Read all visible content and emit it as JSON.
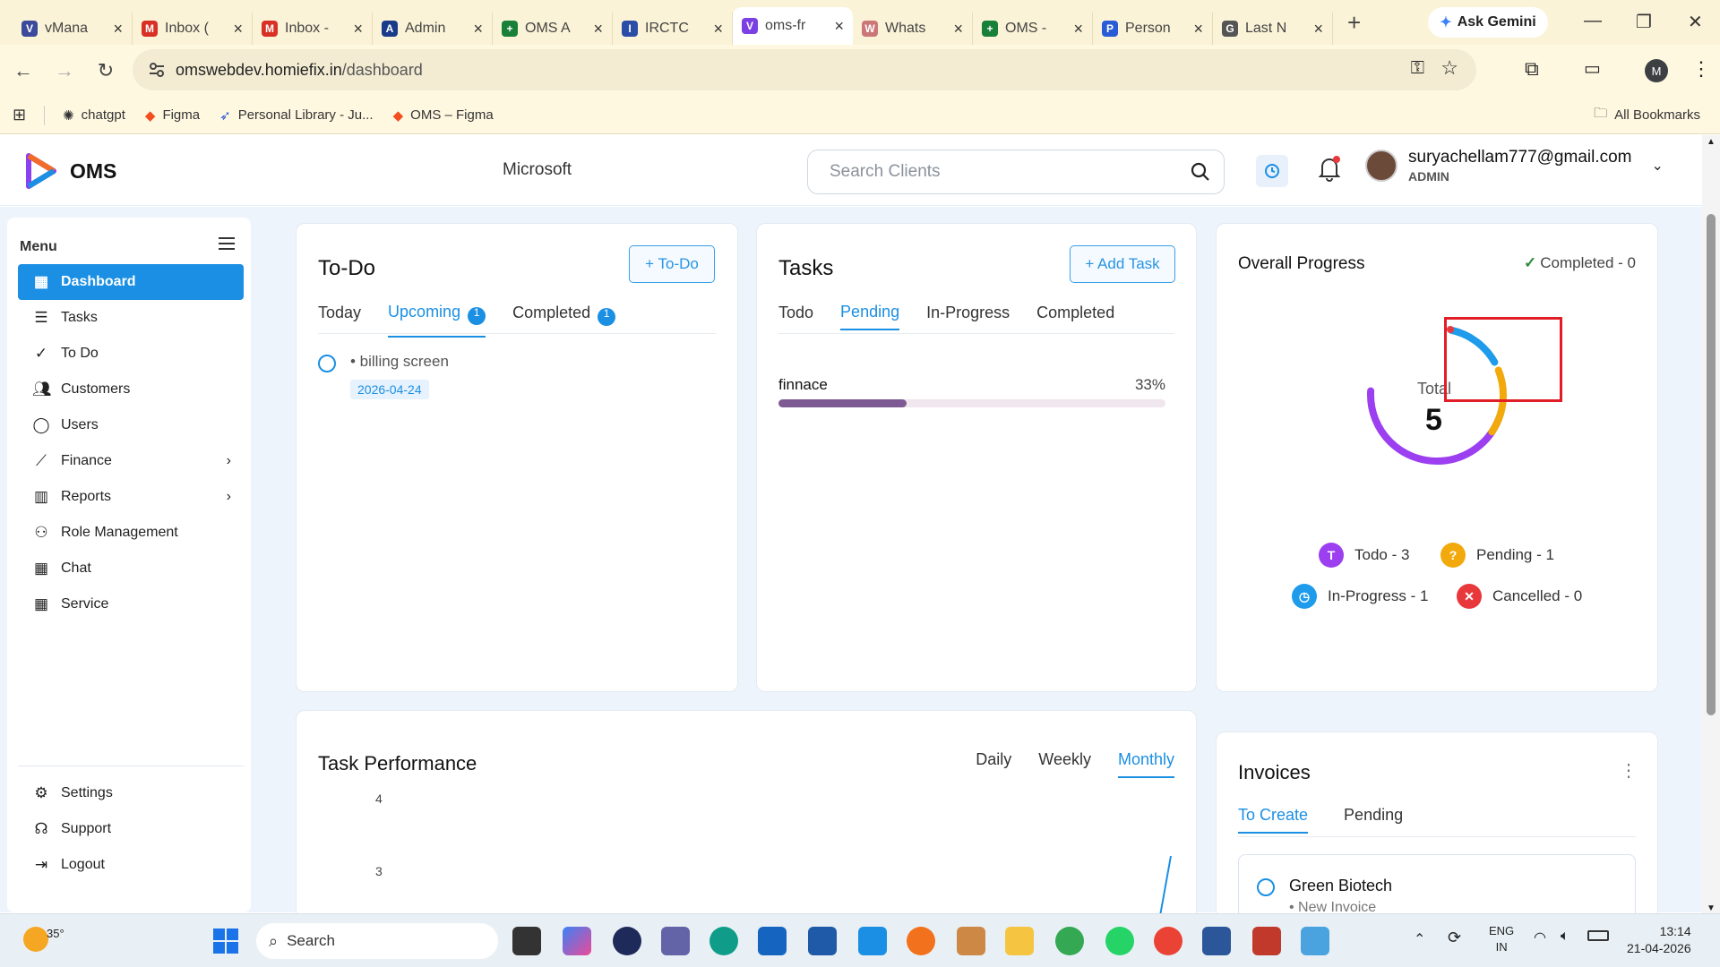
{
  "browser": {
    "tabs": [
      {
        "title": "vMana",
        "color": "#3b4a9a",
        "glyph": "V"
      },
      {
        "title": "Inbox (",
        "color": "#d93025",
        "glyph": "M"
      },
      {
        "title": "Inbox -",
        "color": "#d93025",
        "glyph": "M"
      },
      {
        "title": "Admin",
        "color": "#1a3a8a",
        "glyph": "A"
      },
      {
        "title": "OMS A",
        "color": "#188038",
        "glyph": "+"
      },
      {
        "title": "IRCTC",
        "color": "#2a4ea8",
        "glyph": "I"
      },
      {
        "title": "oms-fr",
        "color": "#7b3fe4",
        "glyph": "V",
        "active": true
      },
      {
        "title": "Whats",
        "color": "#c77",
        "glyph": "W"
      },
      {
        "title": "OMS -",
        "color": "#188038",
        "glyph": "+"
      },
      {
        "title": "Person",
        "color": "#2a5bd7",
        "glyph": "P"
      },
      {
        "title": "Last N",
        "color": "#555",
        "glyph": "G"
      }
    ],
    "ask_gemini": "Ask Gemini",
    "url_host": "omswebdev.homiefix.in",
    "url_path": "/dashboard",
    "profile_initial": "M",
    "bookmarks": [
      "chatgpt",
      "Figma",
      "Personal Library - Ju...",
      "OMS – Figma"
    ],
    "all_bookmarks": "All Bookmarks"
  },
  "header": {
    "brand": "OMS",
    "company": "Microsoft",
    "search_placeholder": "Search Clients",
    "user_email": "suryachellam777@gmail.com",
    "user_role": "ADMIN"
  },
  "sidebar": {
    "title": "Menu",
    "items": [
      {
        "label": "Dashboard",
        "icon": "dashboard-icon",
        "active": true
      },
      {
        "label": "Tasks",
        "icon": "tasks-icon"
      },
      {
        "label": "To Do",
        "icon": "todo-icon"
      },
      {
        "label": "Customers",
        "icon": "customers-icon"
      },
      {
        "label": "Users",
        "icon": "user-icon"
      },
      {
        "label": "Finance",
        "icon": "finance-icon",
        "chevron": true
      },
      {
        "label": "Reports",
        "icon": "reports-icon",
        "chevron": true
      },
      {
        "label": "Role Management",
        "icon": "role-icon"
      },
      {
        "label": "Chat",
        "icon": "chat-icon"
      },
      {
        "label": "Service",
        "icon": "service-icon"
      }
    ],
    "bottom": [
      {
        "label": "Settings",
        "icon": "gear-icon"
      },
      {
        "label": "Support",
        "icon": "headset-icon"
      },
      {
        "label": "Logout",
        "icon": "logout-icon"
      }
    ]
  },
  "todo": {
    "title": "To-Do",
    "add_label": "+ To-Do",
    "tabs": {
      "today": "Today",
      "upcoming": "Upcoming",
      "upcoming_count": "1",
      "completed": "Completed",
      "completed_count": "1"
    },
    "items": [
      {
        "text": "• billing screen",
        "date": "2026-04-24"
      }
    ]
  },
  "tasks": {
    "title": "Tasks",
    "add_label": "+ Add Task",
    "tabs": [
      "Todo",
      "Pending",
      "In-Progress",
      "Completed"
    ],
    "active_tab": "Pending",
    "items": [
      {
        "name": "finnace",
        "percent_label": "33%",
        "progress": 0.33
      }
    ]
  },
  "progress": {
    "title": "Overall Progress",
    "completed_label": "Completed - 0",
    "total_label": "Total",
    "total_value": "5",
    "legend": [
      {
        "label": "Todo - 3",
        "glyph": "T",
        "color": "#9b3ff0"
      },
      {
        "label": "Pending - 1",
        "glyph": "?",
        "color": "#f2a90c"
      },
      {
        "label": "In-Progress - 1",
        "glyph": "◷",
        "color": "#1e9bea"
      },
      {
        "label": "Cancelled - 0",
        "glyph": "✕",
        "color": "#e8383b"
      }
    ]
  },
  "performance": {
    "title": "Task Performance",
    "tabs": [
      "Daily",
      "Weekly",
      "Monthly"
    ],
    "active_tab": "Monthly",
    "y_ticks": [
      "4",
      "3"
    ]
  },
  "invoices": {
    "title": "Invoices",
    "tabs": [
      "To Create",
      "Pending"
    ],
    "active_tab": "To Create",
    "items": [
      {
        "name": "Green Biotech",
        "sub": "• New Invoice"
      }
    ]
  },
  "taskbar": {
    "weather": "35°",
    "search": "Search",
    "lang": "ENG",
    "region": "IN",
    "time": "13:14",
    "date": "21-04-2026"
  }
}
